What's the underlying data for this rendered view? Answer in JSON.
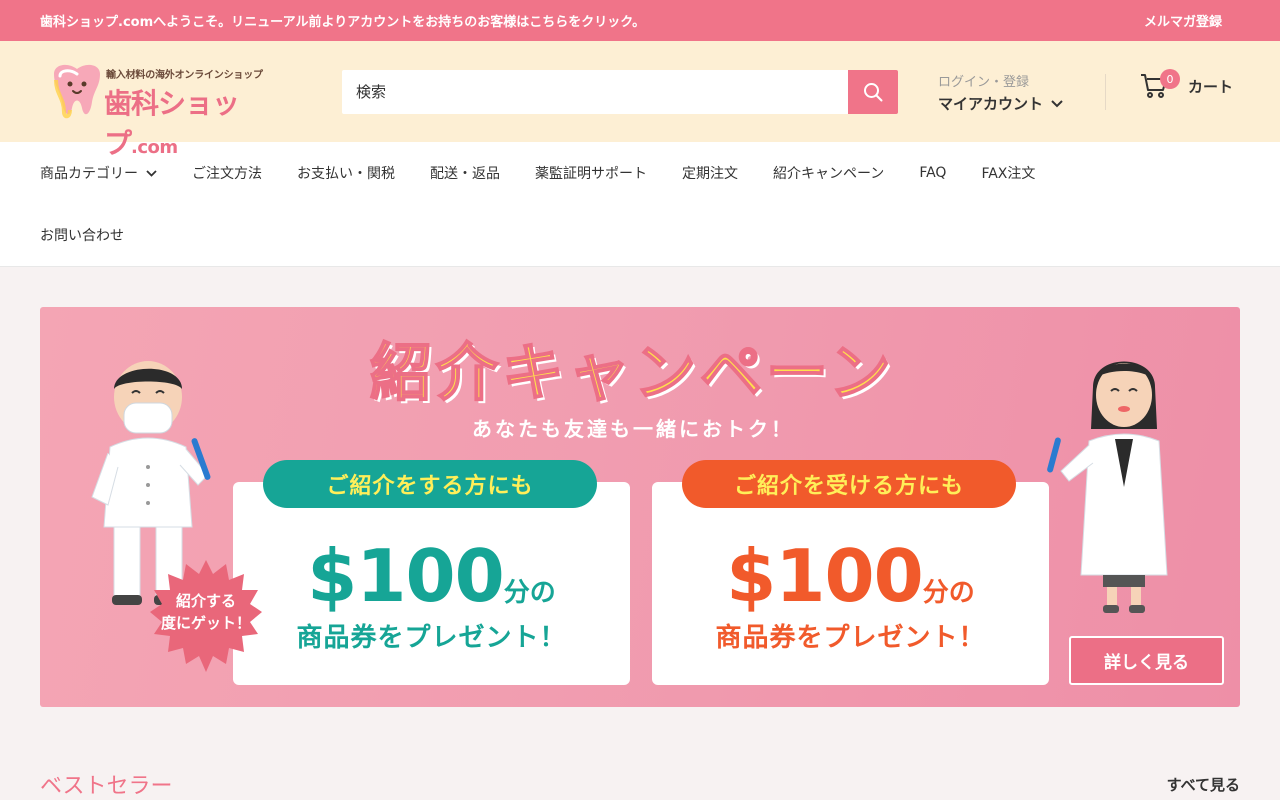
{
  "announcement": {
    "message": "歯科ショップ.comへようこそ。リニューアル前よりアカウントをお持ちのお客様はこちらをクリック。",
    "newsletter": "メルマガ登録"
  },
  "logo": {
    "tagline": "輸入材料の海外オンラインショップ",
    "name": "歯科ショップ",
    "suffix": ".com"
  },
  "search": {
    "placeholder": "検索"
  },
  "account": {
    "login": "ログイン・登録",
    "my_account": "マイアカウント"
  },
  "cart": {
    "count": "0",
    "label": "カート"
  },
  "nav": {
    "items": [
      "商品カテゴリー",
      "ご注文方法",
      "お支払い・関税",
      "配送・返品",
      "薬監証明サポート",
      "定期注文",
      "紹介キャンペーン",
      "FAQ",
      "FAX注文"
    ],
    "row2": [
      "お問い合わせ"
    ]
  },
  "banner": {
    "title": "紹介キャンペーン",
    "subtitle": "あなたも友達も一緒におトク！",
    "left_card": {
      "pill": "ご紹介をする方にも",
      "amount": "$100",
      "unit": "分の",
      "gift": "商品券をプレゼント！"
    },
    "right_card": {
      "pill": "ご紹介を受ける方にも",
      "amount": "$100",
      "unit": "分の",
      "gift": "商品券をプレゼント！"
    },
    "burst_line1": "紹介する",
    "burst_line2": "度にゲット！",
    "details_button": "詳しく見る"
  },
  "best_sellers": {
    "title": "ベストセラー",
    "see_all": "すべて見る"
  },
  "colors": {
    "brand_pink": "#f07489",
    "cream": "#fdefd4",
    "teal": "#16a596",
    "orange": "#f15a2b",
    "yellow": "#ffe04c"
  }
}
